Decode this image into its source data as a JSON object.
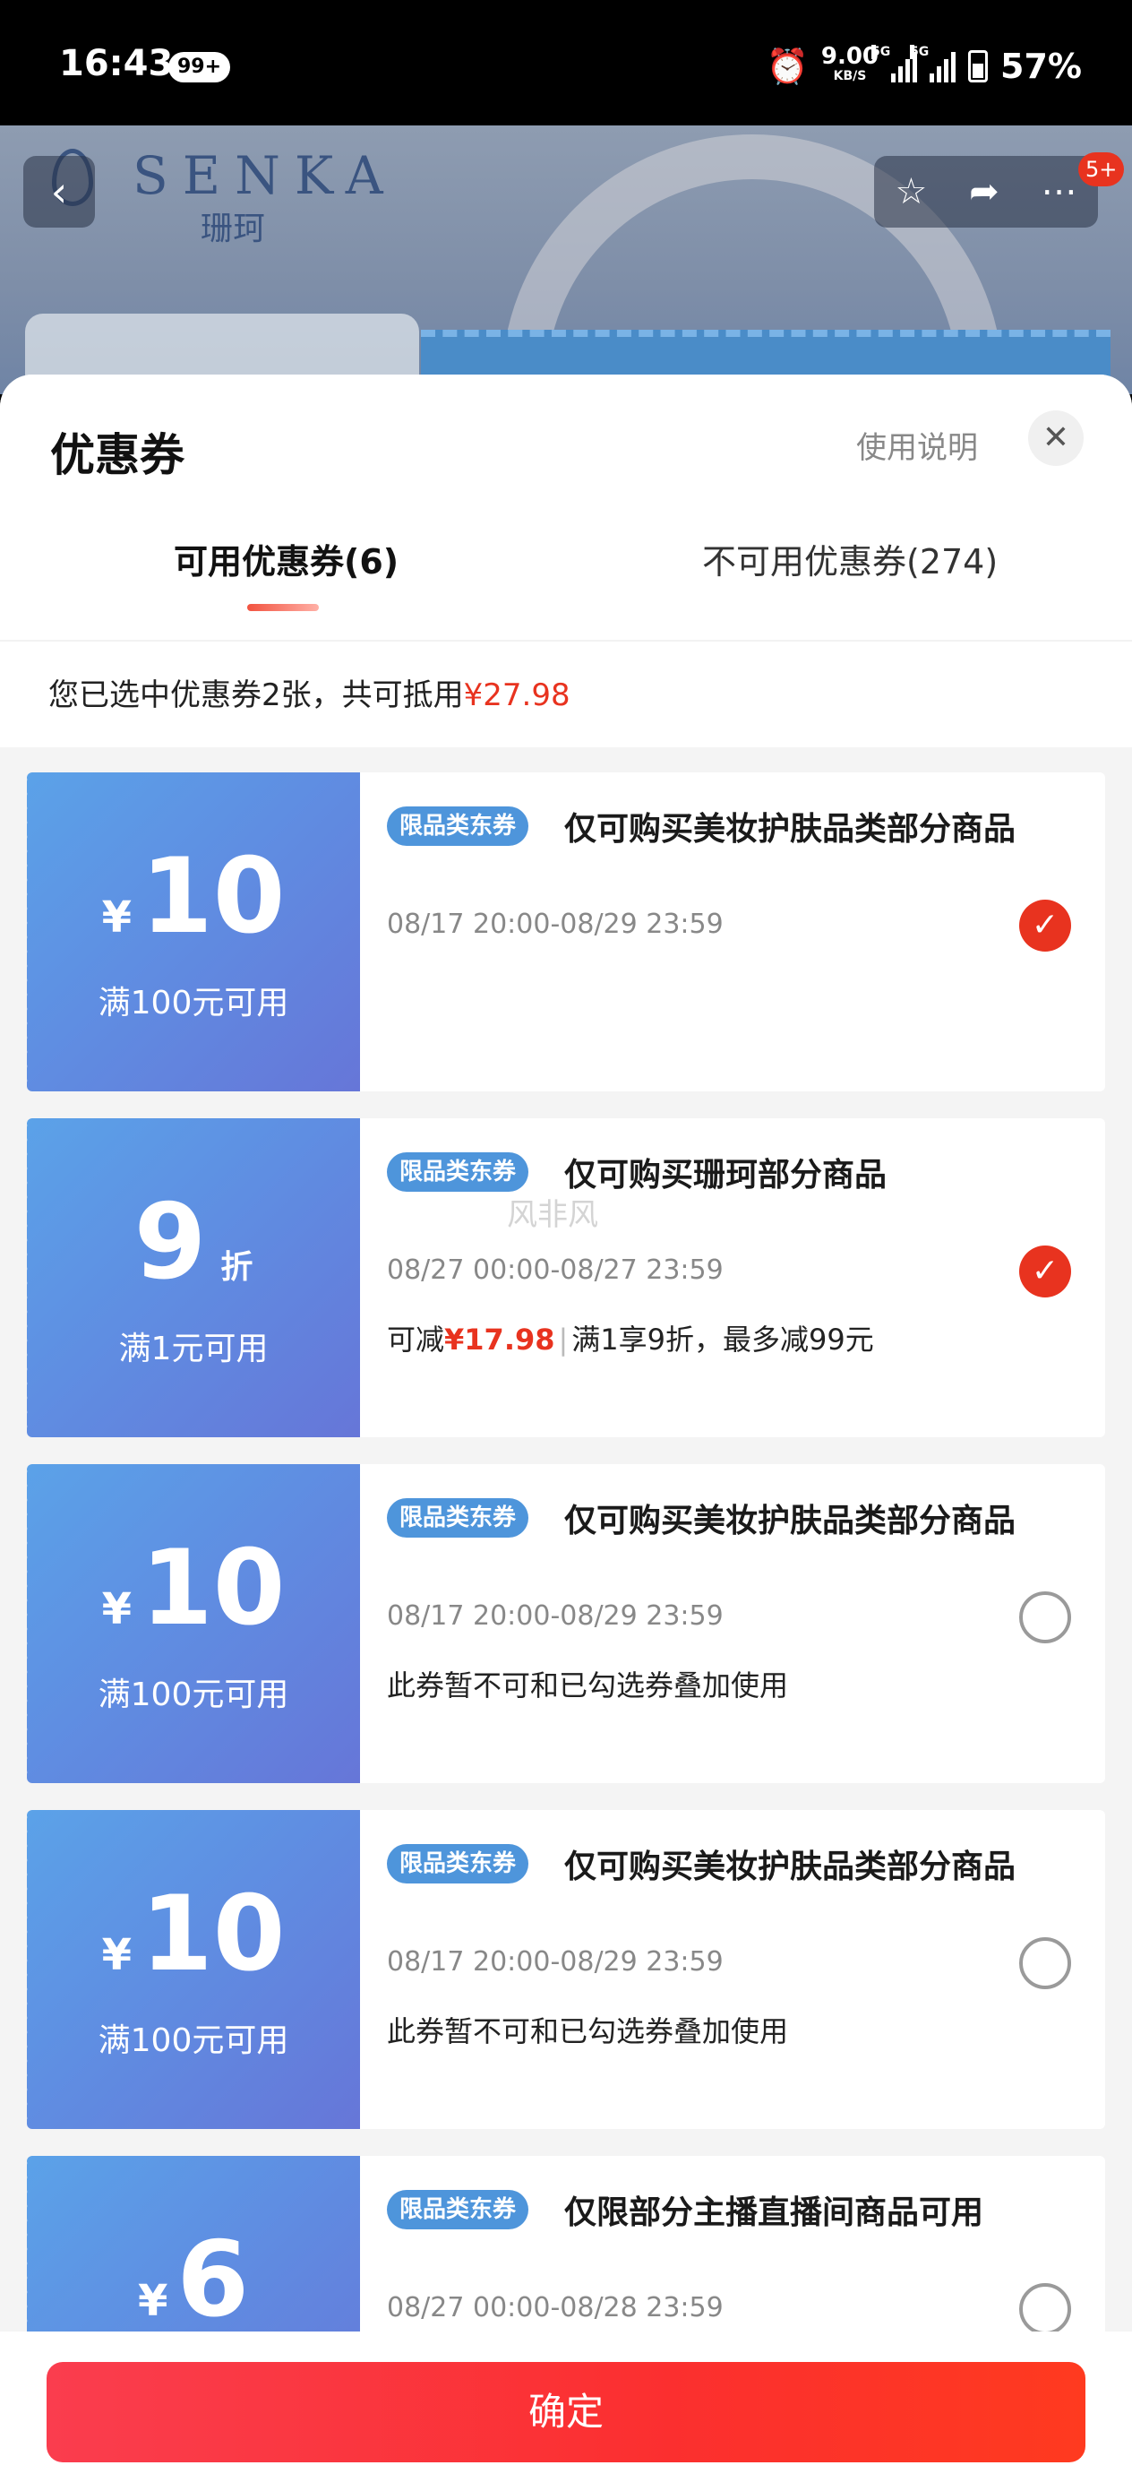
{
  "status_bar": {
    "time": "16:43",
    "notification_count": "99+",
    "net_speed": "9.00",
    "net_speed_unit": "KB/S",
    "signal_tag": "5G",
    "battery": "57%"
  },
  "product_header": {
    "brand_en": "SENKA",
    "brand_cn": "珊珂",
    "badge": "5+"
  },
  "sheet": {
    "title": "优惠券",
    "help_link": "使用说明",
    "tabs": [
      {
        "label": "可用优惠券(6)",
        "active": true
      },
      {
        "label": "不可用优惠券(274)",
        "active": false
      }
    ],
    "summary": {
      "text": "您已选中优惠券2张，共可抵用",
      "amount": "¥27.98"
    }
  },
  "coupons": [
    {
      "currency": "¥",
      "value": "10",
      "unit": "",
      "condition": "满100元可用",
      "tag": "限品类东券",
      "title": "仅可购买美妆护肤品类部分商品",
      "date": "08/17 20:00-08/29 23:59",
      "note": "",
      "checked": true
    },
    {
      "currency": "",
      "value": "9",
      "unit": "折",
      "condition": "满1元可用",
      "tag": "限品类东券",
      "title": "仅可购买珊珂部分商品",
      "date": "08/27 00:00-08/27 23:59",
      "note_prefix": "可减",
      "note_amount": "¥17.98",
      "note_rest": "满1享9折，最多减99元",
      "watermark": "风非风",
      "checked": true
    },
    {
      "currency": "¥",
      "value": "10",
      "unit": "",
      "condition": "满100元可用",
      "tag": "限品类东券",
      "title": "仅可购买美妆护肤品类部分商品",
      "date": "08/17 20:00-08/29 23:59",
      "note": "此券暂不可和已勾选券叠加使用",
      "checked": false
    },
    {
      "currency": "¥",
      "value": "10",
      "unit": "",
      "condition": "满100元可用",
      "tag": "限品类东券",
      "title": "仅可购买美妆护肤品类部分商品",
      "date": "08/17 20:00-08/29 23:59",
      "note": "此券暂不可和已勾选券叠加使用",
      "checked": false
    },
    {
      "currency": "¥",
      "value": "6",
      "unit": "",
      "condition": "",
      "tag": "限品类东券",
      "title": "仅限部分主播直播间商品可用",
      "date": "08/27 00:00-08/28 23:59",
      "note": "",
      "checked": false
    }
  ],
  "footer": {
    "confirm_label": "确定"
  },
  "colors": {
    "accent_red": "#e8331f",
    "coupon_blue_start": "#5ba2e8",
    "coupon_blue_end": "#6676d8",
    "tag_blue": "#4e95db"
  }
}
